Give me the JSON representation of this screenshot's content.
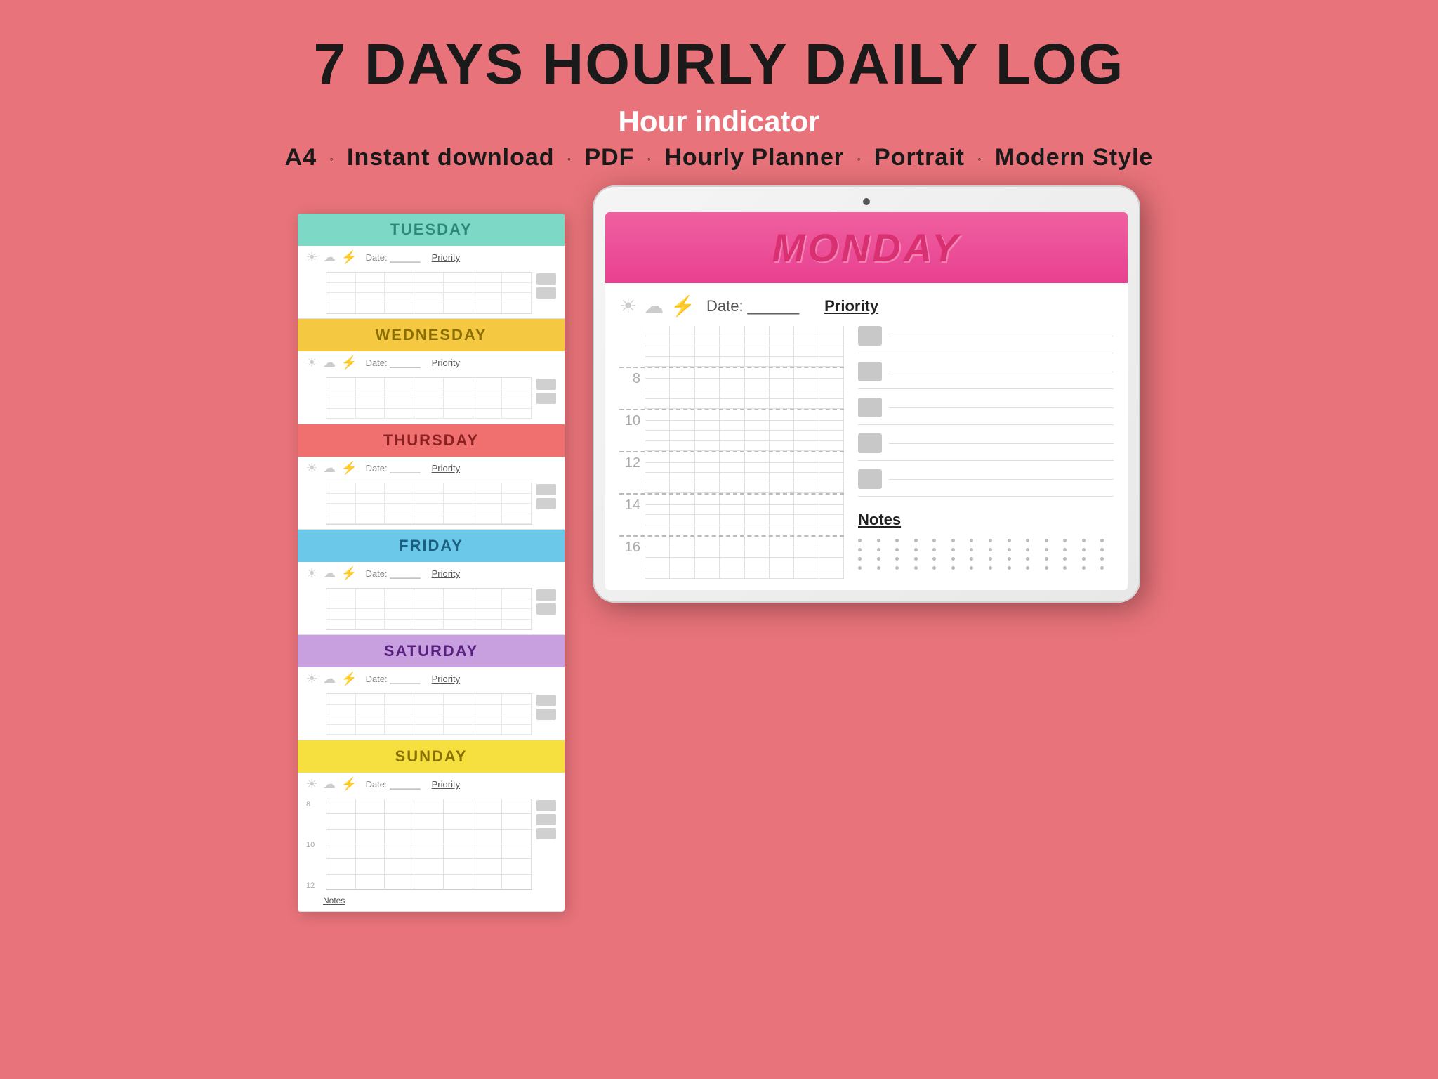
{
  "page": {
    "title": "7 DAYS HOURLY DAILY LOG",
    "subtitle": "Hour indicator",
    "meta": {
      "items": [
        "A4",
        "Instant download",
        "PDF",
        "Hourly Planner",
        "Portrait",
        "Modern Style"
      ]
    }
  },
  "left_planner": {
    "days": [
      {
        "name": "TUESDAY",
        "class": "tuesday"
      },
      {
        "name": "WEDNESDAY",
        "class": "wednesday"
      },
      {
        "name": "THURSDAY",
        "class": "thursday"
      },
      {
        "name": "FRIDAY",
        "class": "friday"
      },
      {
        "name": "SATURDAY",
        "class": "saturday"
      },
      {
        "name": "SUNDAY",
        "class": "sunday"
      }
    ],
    "date_label": "Date:",
    "priority_label": "Priority",
    "notes_label": "Notes",
    "hours": [
      "8",
      "10",
      "12"
    ]
  },
  "tablet": {
    "day": "MONDAY",
    "date_label": "Date:",
    "priority_label": "Priority",
    "notes_label": "Notes",
    "hours": [
      "8",
      "10",
      "12",
      "14",
      "16"
    ],
    "priority_count": 5,
    "notes_dots": 56
  }
}
